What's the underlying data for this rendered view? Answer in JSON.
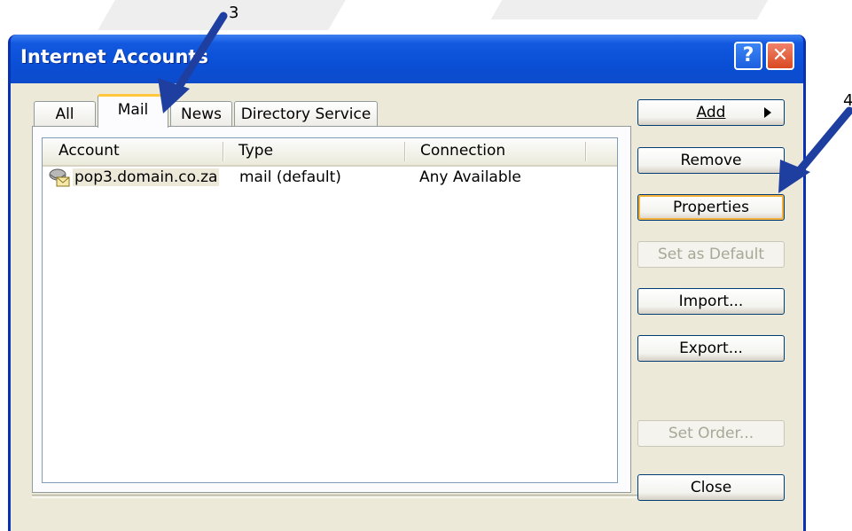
{
  "window": {
    "title": "Internet Accounts",
    "help_glyph": "?",
    "close_glyph": "✕"
  },
  "tabs": [
    {
      "label": "All",
      "active": false
    },
    {
      "label": "Mail",
      "active": true
    },
    {
      "label": "News",
      "active": false
    },
    {
      "label": "Directory Service",
      "active": false
    }
  ],
  "list": {
    "columns": [
      "Account",
      "Type",
      "Connection"
    ],
    "rows": [
      {
        "account": "pop3.domain.co.za",
        "type": "mail (default)",
        "connection": "Any Available",
        "icon": "mail-account-icon"
      }
    ]
  },
  "buttons": {
    "add": "Add",
    "remove": "Remove",
    "properties": "Properties",
    "set_default": "Set as Default",
    "import": "Import...",
    "export": "Export...",
    "set_order": "Set Order...",
    "close": "Close"
  },
  "annotations": {
    "step_tab": "3",
    "step_properties": "4"
  },
  "colors": {
    "titlebar": "#0a52d8",
    "arrow": "#1f3fa0",
    "tab_highlight": "#ffc83c"
  }
}
